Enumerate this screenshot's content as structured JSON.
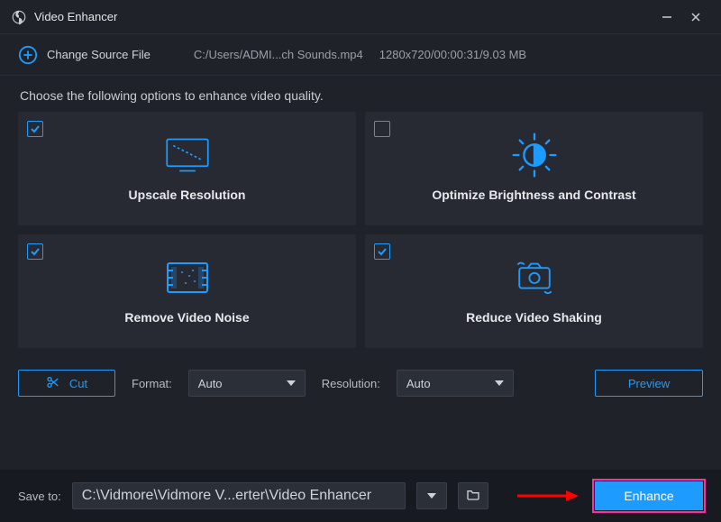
{
  "window": {
    "title": "Video Enhancer"
  },
  "source": {
    "change_label": "Change Source File",
    "path": "C:/Users/ADMI...ch Sounds.mp4",
    "meta": "1280x720/00:00:31/9.03 MB"
  },
  "instruction": "Choose the following options to enhance video quality.",
  "cards": {
    "upscale": {
      "label": "Upscale Resolution",
      "checked": true
    },
    "optimize": {
      "label": "Optimize Brightness and Contrast",
      "checked": false
    },
    "noise": {
      "label": "Remove Video Noise",
      "checked": true
    },
    "shaking": {
      "label": "Reduce Video Shaking",
      "checked": true
    }
  },
  "toolbar": {
    "cut_label": "Cut",
    "format_label": "Format:",
    "format_value": "Auto",
    "resolution_label": "Resolution:",
    "resolution_value": "Auto",
    "preview_label": "Preview"
  },
  "footer": {
    "save_to_label": "Save to:",
    "save_path": "C:\\Vidmore\\Vidmore V...erter\\Video Enhancer",
    "enhance_label": "Enhance"
  },
  "colors": {
    "accent": "#1e9bff",
    "highlight": "#ff2fa0",
    "arrow": "#ff0000"
  }
}
